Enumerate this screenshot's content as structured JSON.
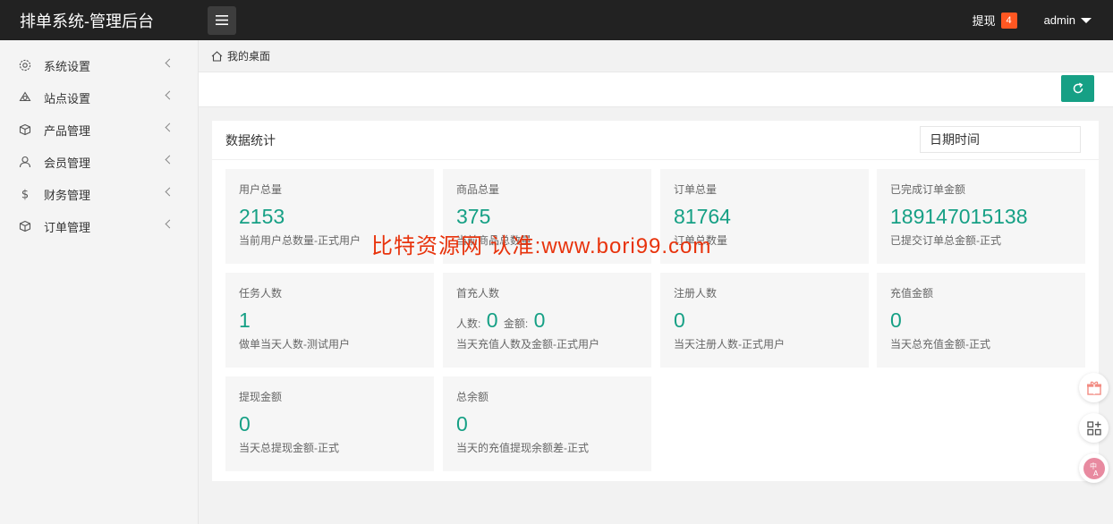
{
  "header": {
    "title": "排单系统-管理后台",
    "withdraw_label": "提现",
    "withdraw_count": "4",
    "user": "admin"
  },
  "sidebar": {
    "items": [
      {
        "label": "系统设置",
        "icon": "gear-icon"
      },
      {
        "label": "站点设置",
        "icon": "hub-icon"
      },
      {
        "label": "产品管理",
        "icon": "box-icon"
      },
      {
        "label": "会员管理",
        "icon": "user-icon"
      },
      {
        "label": "财务管理",
        "icon": "dollar-icon"
      },
      {
        "label": "订单管理",
        "icon": "cube-icon"
      }
    ]
  },
  "breadcrumb": {
    "label": "我的桌面"
  },
  "card": {
    "title": "数据统计",
    "date_placeholder": "日期时间"
  },
  "stats": [
    {
      "label": "用户总量",
      "value": "2153",
      "sub": "当前用户总数量-正式用户"
    },
    {
      "label": "商品总量",
      "value": "375",
      "sub": "当前商品总数量"
    },
    {
      "label": "订单总量",
      "value": "81764",
      "sub": "订单总数量"
    },
    {
      "label": "已完成订单金额",
      "value": "189147015138",
      "sub": "已提交订单总金额-正式"
    },
    {
      "label": "任务人数",
      "value": "1",
      "sub": "做单当天人数-测试用户"
    },
    {
      "label": "首充人数",
      "count_label": "人数:",
      "count_value": "0",
      "amount_label": "金额:",
      "amount_value": "0",
      "sub": "当天充值人数及金额-正式用户"
    },
    {
      "label": "注册人数",
      "value": "0",
      "sub": "当天注册人数-正式用户"
    },
    {
      "label": "充值金额",
      "value": "0",
      "sub": "当天总充值金额-正式"
    },
    {
      "label": "提现金额",
      "value": "0",
      "sub": "当天总提现金额-正式"
    },
    {
      "label": "总余额",
      "value": "0",
      "sub": "当天的充值提现余额差-正式"
    }
  ],
  "watermark": "比特资源网 认准:www.bori99.com",
  "colors": {
    "accent": "#16a085",
    "header": "#222222",
    "badge": "#ff5722"
  }
}
